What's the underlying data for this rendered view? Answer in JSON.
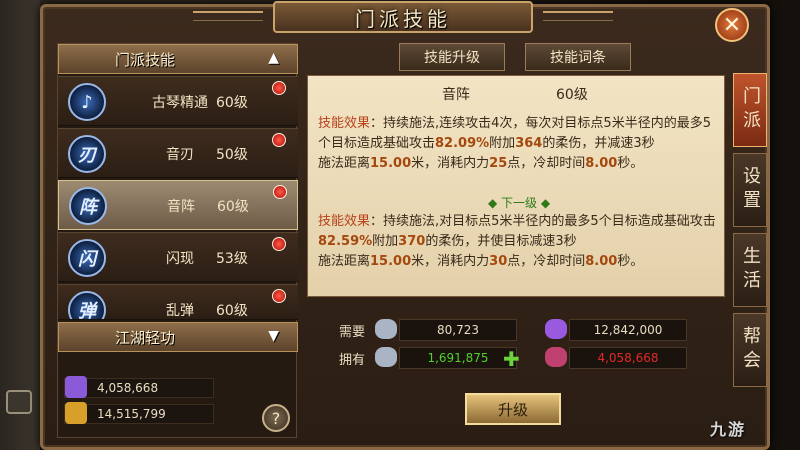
{
  "window": {
    "title": "门派技能",
    "close_label": "✕"
  },
  "left_list": {
    "header_title": "门派技能",
    "skills": [
      {
        "name": "古琴精通",
        "level": "60级",
        "icon_glyph": "♪"
      },
      {
        "name": "音刃",
        "level": "50级",
        "icon_glyph": "刃"
      },
      {
        "name": "音阵",
        "level": "60级",
        "icon_glyph": "阵"
      },
      {
        "name": "闪现",
        "level": "53级",
        "icon_glyph": "闪"
      },
      {
        "name": "乱弹",
        "level": "60级",
        "icon_glyph": "弹"
      }
    ],
    "selected_index": 2,
    "footer_section": "江湖轻功"
  },
  "resources": [
    {
      "value": "4,058,668",
      "icon": "purple-gem-icon",
      "color": "#8a5ad8"
    },
    {
      "value": "14,515,799",
      "icon": "gold-ingot-icon",
      "color": "#d8a02a"
    }
  ],
  "help_label": "?",
  "tabs": {
    "upgrade": "技能升级",
    "traits": "技能词条"
  },
  "detail": {
    "skill_name": "音阵",
    "skill_level": "60级",
    "current": {
      "label": "技能效果",
      "t1": "：持续施法,连续攻击4次，每次对目标点5米半径内的最多5个目标造成基础攻击",
      "pct": "82.09%",
      "t2": "附加",
      "dmg": "364",
      "t3": "的柔伤，并减速3秒",
      "r1": "施法距离",
      "range": "15.00",
      "r2": "米，消耗内力",
      "mp": "25",
      "r3": "点，冷却时间",
      "cd": "8.00",
      "r4": "秒。"
    },
    "next_label": "◆ 下一级 ◆",
    "next": {
      "label": "技能效果",
      "t1": "：持续施法,对目标点5米半径内的最多5个目标造成基础攻击",
      "pct": "82.59%",
      "t2": "附加",
      "dmg": "370",
      "t3": "的柔伤，并使目标减速3秒",
      "r1": "施法距离",
      "range": "15.00",
      "r2": "米，消耗内力",
      "mp": "30",
      "r3": "点，冷却时间",
      "cd": "8.00",
      "r4": "秒。"
    }
  },
  "cost": {
    "need_label": "需要",
    "have_label": "拥有",
    "need_silver": "80,723",
    "need_gem": "12,842,000",
    "have_silver": "1,691,875",
    "have_gem": "4,058,668",
    "have_silver_color": "#4fd12a",
    "have_gem_color": "#e02a2a",
    "plus_label": "✚"
  },
  "upgrade_label": "升级",
  "side_tabs": [
    "门派",
    "设置",
    "生活",
    "帮会"
  ],
  "watermark": "九游"
}
